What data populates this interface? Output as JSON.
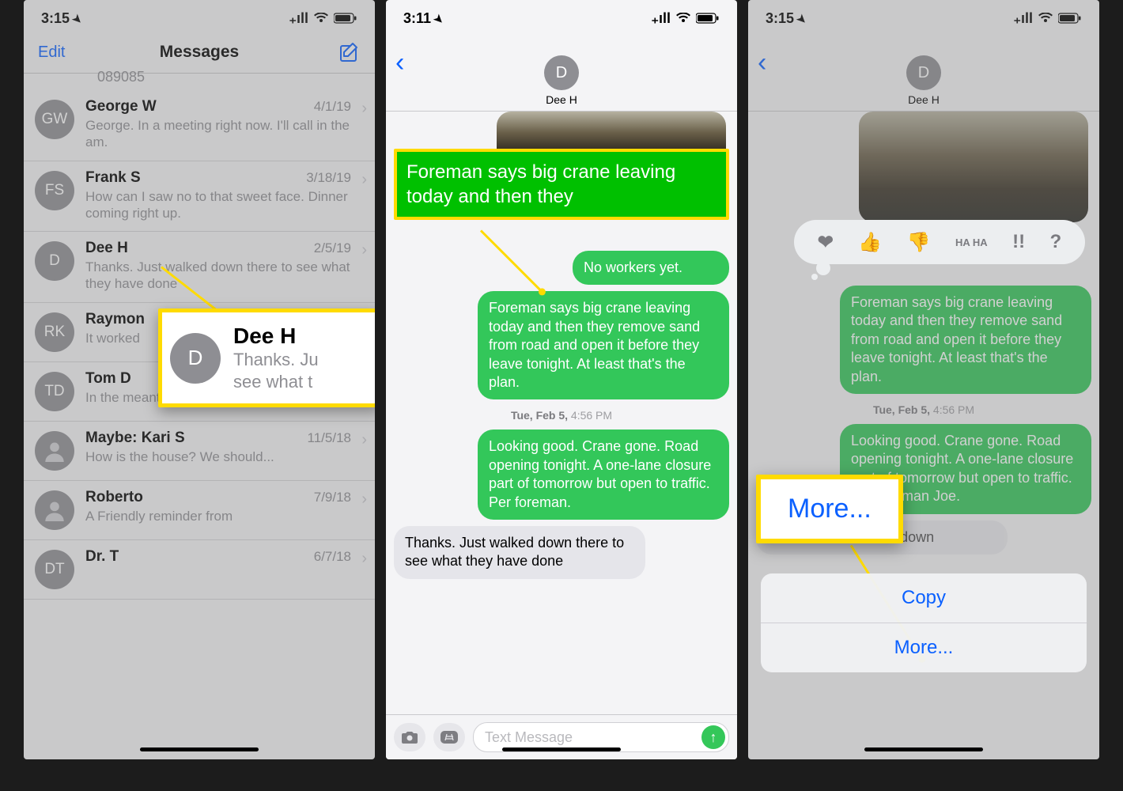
{
  "screens": {
    "list": {
      "status_time": "3:15",
      "nav": {
        "edit": "Edit",
        "title": "Messages"
      },
      "partial_top": "089085",
      "rows": [
        {
          "initials": "GW",
          "name": "George W",
          "date": "4/1/19",
          "preview": "George. In a meeting right now. I'll call in the am."
        },
        {
          "initials": "FS",
          "name": "Frank S",
          "date": "3/18/19",
          "preview": "How can I saw no to that sweet face. Dinner coming right up."
        },
        {
          "initials": "D",
          "name": "Dee H",
          "date": "2/5/19",
          "preview": "Thanks. Just walked down there to see what they have done"
        },
        {
          "initials": "RK",
          "name": "Raymon",
          "date": "",
          "preview": "It worked"
        },
        {
          "initials": "TD",
          "name": "Tom D",
          "date": "",
          "preview": "In the meantime my car will look v..."
        },
        {
          "initials": "",
          "name": "Maybe: Kari S",
          "date": "11/5/18",
          "preview": "How is the house?  We should..."
        },
        {
          "initials": "",
          "name": "Roberto",
          "date": "7/9/18",
          "preview": "A Friendly reminder from"
        },
        {
          "initials": "DT",
          "name": "Dr.  T",
          "date": "6/7/18",
          "preview": ""
        }
      ],
      "callout": {
        "name": "Dee H",
        "preview_l1": "Thanks. Ju",
        "preview_l2": "see what t"
      }
    },
    "chat": {
      "status_time": "3:11",
      "contact": "Dee H",
      "contact_initial": "D",
      "msgs": {
        "m1": "No workers yet.",
        "m2": "Foreman says big crane leaving today and then they remove sand from road and open it before they leave tonight. At least that's the plan.",
        "stamp_bold": "Tue, Feb 5,",
        "stamp_light": " 4:56 PM",
        "m3": "Looking good. Crane gone. Road opening tonight. A one-lane closure part of tomorrow but open to traffic. Per foreman.",
        "m4": "Thanks. Just walked down there to see what they have done"
      },
      "banner": "Foreman says big crane leaving today and then they",
      "input_placeholder": "Text Message"
    },
    "menu": {
      "status_time": "3:15",
      "contact": "Dee H",
      "contact_initial": "D",
      "msgs": {
        "m2": "Foreman says big crane leaving today and then they remove sand from road and open it before they leave tonight. At least that's the plan.",
        "stamp_bold": "Tue, Feb 5,",
        "stamp_light": " 4:56 PM",
        "m3": "Looking good. Crane gone. Road opening tonight. A one-lane closure part of tomorrow but open to traffic. Per foreman Joe.",
        "m4": "Thanks. Just walked down"
      },
      "tapbacks": [
        "❤",
        "👍",
        "👎",
        "HA HA",
        "!!",
        "?"
      ],
      "sheet": {
        "copy": "Copy",
        "more": "More..."
      },
      "callout_more": "More..."
    }
  }
}
